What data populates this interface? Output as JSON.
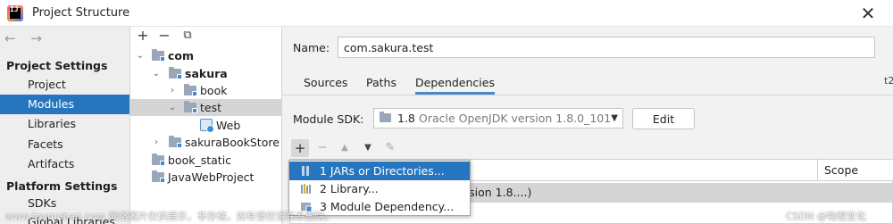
{
  "window": {
    "title": "Project Structure",
    "app_icon_text": "IJ",
    "close_glyph": "✕"
  },
  "nav": {
    "back_forward": "← →",
    "sections": [
      {
        "title": "Project Settings",
        "items": [
          "Project",
          "Modules",
          "Libraries",
          "Facets",
          "Artifacts"
        ]
      },
      {
        "title": "Platform Settings",
        "items": [
          "SDKs",
          "Global Libraries"
        ]
      }
    ],
    "active_item": "Modules"
  },
  "tree": {
    "toolbar": {
      "add": "+",
      "remove": "−",
      "copy": "⧉"
    },
    "nodes": [
      {
        "label": "com",
        "bold": true,
        "expanded": true
      },
      {
        "label": "sakura",
        "bold": true,
        "expanded": true
      },
      {
        "label": "book",
        "bold": false,
        "expanded": false
      },
      {
        "label": "test",
        "bold": false,
        "expanded": true,
        "selected": true
      },
      {
        "label": "Web",
        "bold": false
      },
      {
        "label": "sakuraBookStore",
        "bold": false,
        "expanded": false
      },
      {
        "label": "book_static",
        "bold": false
      },
      {
        "label": "JavaWebProject",
        "bold": false
      }
    ]
  },
  "module": {
    "name_label": "Name:",
    "name_value": "com.sakura.test",
    "tabs": [
      "Sources",
      "Paths",
      "Dependencies"
    ],
    "active_tab": "Dependencies",
    "sdk_label": "Module SDK:",
    "sdk_version": "1.8",
    "sdk_desc": "Oracle OpenJDK version 1.8.0_101",
    "edit_label": "Edit",
    "dep_toolbar": {
      "add": "+",
      "remove": "−",
      "up": "▲",
      "down": "▼",
      "edit": "✎"
    },
    "table": {
      "scope_header": "Scope",
      "row_text": "rsion 1.8....)"
    }
  },
  "popup": {
    "items": [
      {
        "label": "1  JARs or Directories...",
        "icon": "jar-icon"
      },
      {
        "label": "2  Library...",
        "icon": "library-icon"
      },
      {
        "label": "3  Module Dependency...",
        "icon": "module-icon"
      }
    ],
    "highlighted_index": 0
  },
  "right_edge_text": "t2",
  "watermark": {
    "left": "www.toymoban.com 网络图片仅供展示，非存储，如有侵权请联系删除。",
    "right": "CSDN @物理变化"
  },
  "colors": {
    "accent": "#2675bf",
    "selection_gray": "#d5d5d5",
    "tab_underline": "#4a88c7"
  }
}
